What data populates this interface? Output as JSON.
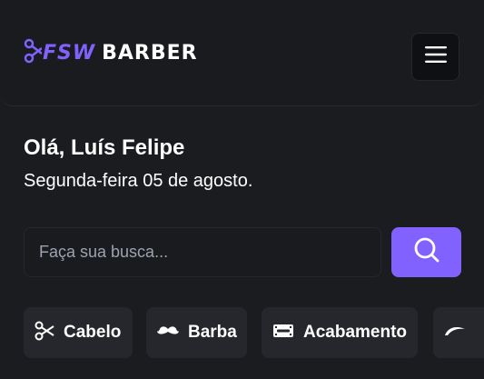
{
  "header": {
    "logo": {
      "part1": "FSW",
      "part2": "BARBER"
    },
    "menu_icon": "hamburger-menu-icon"
  },
  "welcome": {
    "greeting": "Olá, Luís Felipe",
    "date": "Segunda-feira 05 de agosto."
  },
  "search": {
    "placeholder": "Faça sua busca...",
    "value": "",
    "button_icon": "search-icon"
  },
  "quick_search": [
    {
      "label": "Cabelo",
      "icon": "scissors-icon"
    },
    {
      "label": "Barba",
      "icon": "mustache-icon"
    },
    {
      "label": "Acabamento",
      "icon": "razor-icon"
    },
    {
      "label": "",
      "icon": "eyebrow-icon"
    }
  ],
  "colors": {
    "accent": "#8162ff",
    "background": "#1b1c20",
    "card": "#26272c"
  }
}
